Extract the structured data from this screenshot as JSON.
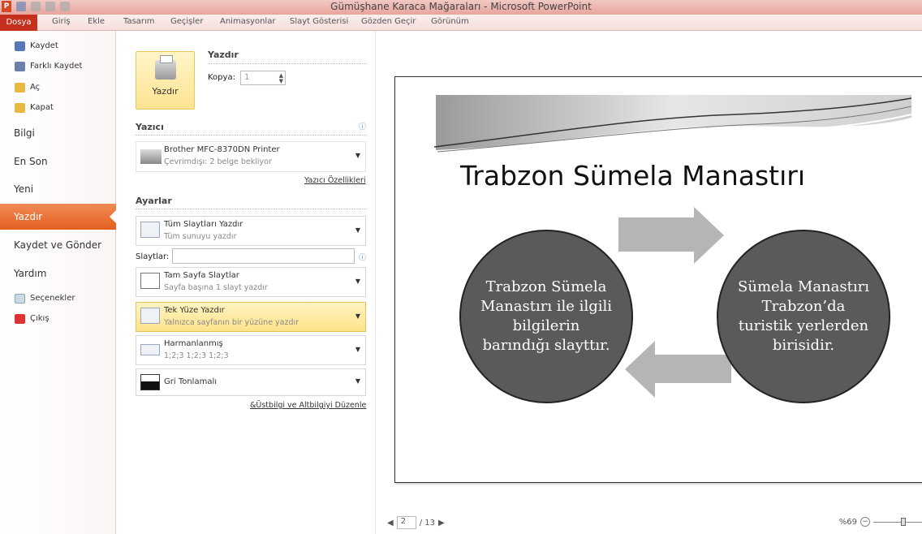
{
  "window": {
    "title": "Gümüşhane Karaca Mağaraları - Microsoft PowerPoint",
    "app_icon": "P"
  },
  "ribbon_tabs": [
    "Dosya",
    "Giriş",
    "Ekle",
    "Tasarım",
    "Geçişler",
    "Animasyonlar",
    "Slayt Gösterisi",
    "Gözden Geçir",
    "Görünüm"
  ],
  "nav": {
    "save": "Kaydet",
    "save_as": "Farklı Kaydet",
    "open": "Aç",
    "close": "Kapat",
    "info": "Bilgi",
    "recent": "En Son",
    "new": "Yeni",
    "print": "Yazdır",
    "save_send": "Kaydet ve Gönder",
    "help": "Yardım",
    "options": "Seçenekler",
    "exit": "Çıkış"
  },
  "print": {
    "section_title": "Yazdır",
    "button_label": "Yazdır",
    "copies_label": "Kopya:",
    "copies_value": "1"
  },
  "printer": {
    "section_title": "Yazıcı",
    "name": "Brother MFC-8370DN Printer",
    "status": "Çevrimdışı: 2 belge bekliyor",
    "properties_link": "Yazıcı Özellikleri"
  },
  "settings": {
    "section_title": "Ayarlar",
    "slides_label": "Slaytlar:",
    "range": {
      "title": "Tüm Slaytları Yazdır",
      "desc": "Tüm sunuyu yazdır"
    },
    "layout": {
      "title": "Tam Sayfa Slaytlar",
      "desc": "Sayfa başına 1 slayt yazdır"
    },
    "sides": {
      "title": "Tek Yüze Yazdır",
      "desc": "Yalnızca sayfanın bir yüzüne yazdır"
    },
    "collate": {
      "title": "Harmanlanmış",
      "desc": "1;2;3   1;2;3   1;2;3"
    },
    "color": {
      "title": "Gri Tonlamalı"
    },
    "header_footer_link": "&Üstbilgi ve Altbilgiyi Düzenle"
  },
  "slide": {
    "title": "Trabzon Sümela Manastırı",
    "left_circle": "Trabzon Sümela Manastırı ile ilgili bilgilerin barındığı slayttır.",
    "right_circle": "Sümela Manastırı Trabzon’da turistik yerlerden birisidir."
  },
  "pager": {
    "current": "2",
    "total": "/ 13"
  },
  "zoom": {
    "label": "%69"
  }
}
